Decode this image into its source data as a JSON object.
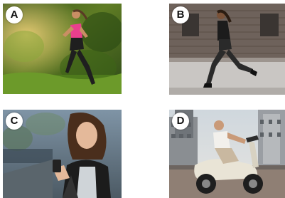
{
  "panels": [
    {
      "label": "A",
      "scene": "woman-running-in-forest"
    },
    {
      "label": "B",
      "scene": "woman-running-by-brick-wall"
    },
    {
      "label": "C",
      "scene": "woman-using-smartphone-on-street"
    },
    {
      "label": "D",
      "scene": "man-riding-scooter-in-city"
    }
  ],
  "colors": {
    "badge_bg": "#ffffff",
    "badge_text": "#111111"
  }
}
